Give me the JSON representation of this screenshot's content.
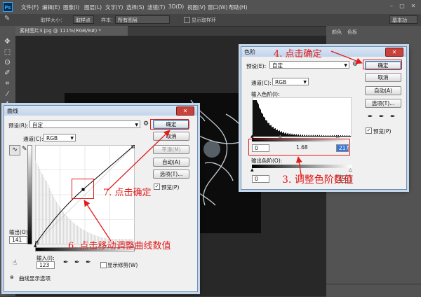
{
  "app": {
    "logo": "Ps",
    "menu": [
      "文件(F)",
      "编辑(E)",
      "图像(I)",
      "图层(L)",
      "文字(Y)",
      "选择(S)",
      "滤镜(T)",
      "3D(D)",
      "视图(V)",
      "窗口(W)",
      "帮助(H)"
    ],
    "options": {
      "sample_size_label": "取样大小：",
      "sample_size_value": "取样点",
      "sample_label": "样本：",
      "sample_value": "所有图层",
      "show_ring_label": "显示取样环",
      "workspace": "基本功"
    },
    "doc_tab": "素材图片3.jpg @ 111%(RGB/8#) *",
    "panel_tabs": [
      "颜色",
      "色板"
    ]
  },
  "curves": {
    "title": "曲线",
    "preset_label": "预设(R):",
    "preset_value": "自定",
    "channel_label": "通道(C):",
    "channel_value": "RGB",
    "buttons": {
      "ok": "确定",
      "cancel": "取消",
      "smooth": "平滑(M)",
      "auto": "自动(A)",
      "options": "选项(T)..."
    },
    "preview_label": "预览(P)",
    "output_label": "输出(O):",
    "output_value": "141",
    "input_label": "输入(I):",
    "input_value": "123",
    "show_clipping_label": "显示修剪(W)",
    "display_options_label": "曲线显示选项"
  },
  "levels": {
    "title": "色阶",
    "preset_label": "预设(E):",
    "preset_value": "自定",
    "channel_label": "通道(C):",
    "channel_value": "RGB",
    "input_levels_label": "输入色阶(I):",
    "input_values": [
      "0",
      "1.68",
      "217"
    ],
    "output_levels_label": "输出色阶(O):",
    "output_values": [
      "0",
      "255"
    ],
    "buttons": {
      "ok": "确定",
      "cancel": "取消",
      "auto": "自动(A)",
      "options": "选项(T)..."
    },
    "preview_label": "预览(P)"
  },
  "annotations": {
    "step3": "3. 调整色阶数值",
    "step4": "4. 点击确定",
    "step6": "6. 点击移动调整曲线数值",
    "step7": "7. 点击确定"
  },
  "colors": {
    "annotation_red": "#e21b1b",
    "ps_dark": "#535353",
    "dialog_bg": "#f0f0f0",
    "accent_blue": "#31a8ff"
  },
  "curve_point": {
    "input": 123,
    "output": 141
  }
}
